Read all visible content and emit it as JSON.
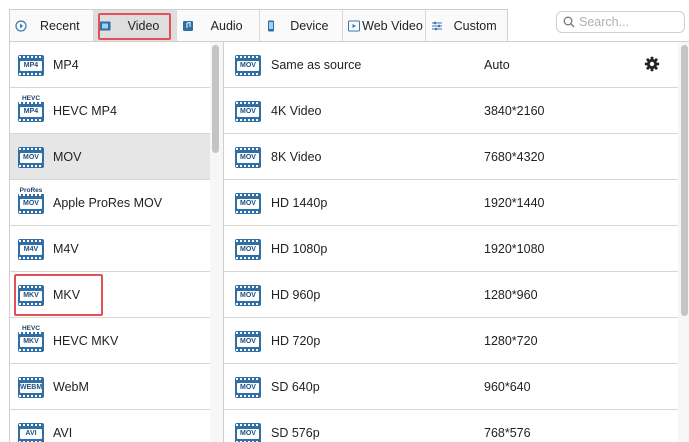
{
  "tabs": [
    {
      "label": "Recent",
      "icon": "recent-icon",
      "active": false
    },
    {
      "label": "Video",
      "icon": "video-icon",
      "active": true
    },
    {
      "label": "Audio",
      "icon": "audio-icon",
      "active": false
    },
    {
      "label": "Device",
      "icon": "device-icon",
      "active": false
    },
    {
      "label": "Web Video",
      "icon": "web-video-icon",
      "active": false
    },
    {
      "label": "Custom",
      "icon": "custom-icon",
      "active": false
    }
  ],
  "search": {
    "placeholder": "Search...",
    "value": ""
  },
  "formats": [
    {
      "label": "MP4",
      "badge": "MP4",
      "top_badge": ""
    },
    {
      "label": "HEVC MP4",
      "badge": "MP4",
      "top_badge": "HEVC"
    },
    {
      "label": "MOV",
      "badge": "MOV",
      "top_badge": "",
      "selected": true
    },
    {
      "label": "Apple ProRes MOV",
      "badge": "MOV",
      "top_badge": "ProRes"
    },
    {
      "label": "M4V",
      "badge": "M4V",
      "top_badge": ""
    },
    {
      "label": "MKV",
      "badge": "MKV",
      "top_badge": "",
      "highlighted": true
    },
    {
      "label": "HEVC MKV",
      "badge": "MKV",
      "top_badge": "HEVC"
    },
    {
      "label": "WebM",
      "badge": "WEBM",
      "top_badge": ""
    },
    {
      "label": "AVI",
      "badge": "AVI",
      "top_badge": ""
    }
  ],
  "presets": [
    {
      "name": "Same as source",
      "resolution": "Auto",
      "badge": "MOV"
    },
    {
      "name": "4K Video",
      "resolution": "3840*2160",
      "badge": "MOV"
    },
    {
      "name": "8K Video",
      "resolution": "7680*4320",
      "badge": "MOV"
    },
    {
      "name": "HD 1440p",
      "resolution": "1920*1440",
      "badge": "MOV"
    },
    {
      "name": "HD 1080p",
      "resolution": "1920*1080",
      "badge": "MOV"
    },
    {
      "name": "HD 960p",
      "resolution": "1280*960",
      "badge": "MOV"
    },
    {
      "name": "HD 720p",
      "resolution": "1280*720",
      "badge": "MOV"
    },
    {
      "name": "SD 640p",
      "resolution": "960*640",
      "badge": "MOV"
    },
    {
      "name": "SD 576p",
      "resolution": "768*576",
      "badge": "MOV"
    }
  ],
  "colors": {
    "highlight": "#e2505a",
    "icon_blue": "#2f6fa6",
    "selected_row": "#e6e6e6"
  },
  "settings_icon": "gear-icon"
}
